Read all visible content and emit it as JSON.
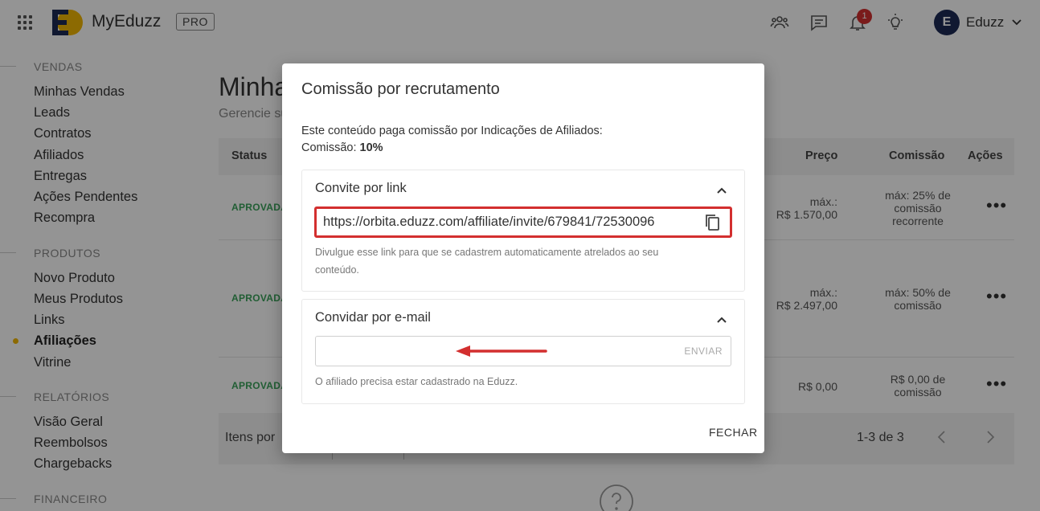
{
  "header": {
    "brand": "MyEduzz",
    "plan_badge": "PRO",
    "notification_count": "1",
    "user_initial": "E",
    "user_name": "Eduzz",
    "icons": [
      "apps-grid-icon",
      "people-icon",
      "chat-icon",
      "bell-icon",
      "lightbulb-icon",
      "chevron-down-icon"
    ],
    "logo_colors": {
      "dark": "#1c2a55",
      "yellow": "#f2b705"
    }
  },
  "sidebar": {
    "sections": [
      {
        "title": "VENDAS",
        "items": [
          "Minhas Vendas",
          "Leads",
          "Contratos",
          "Afiliados",
          "Entregas",
          "Ações Pendentes",
          "Recompra"
        ]
      },
      {
        "title": "PRODUTOS",
        "items": [
          "Novo Produto",
          "Meus Produtos",
          "Links",
          "Afiliações",
          "Vitrine"
        ]
      },
      {
        "title": "RELATÓRIOS",
        "items": [
          "Visão Geral",
          "Reembolsos",
          "Chargebacks"
        ]
      },
      {
        "title": "FINANCEIRO",
        "items": []
      }
    ],
    "active_item": "Afiliações",
    "active_color": "#f2b705"
  },
  "main": {
    "title": "Minhas Afiliações",
    "subtitle": "Gerencie suas afiliações",
    "columns": {
      "status": "Status",
      "price": "Preço",
      "commission": "Comissão",
      "actions": "Ações"
    },
    "rows": [
      {
        "status": "APROVADA",
        "price_line1": "máx.:",
        "price_line2": "R$ 1.570,00",
        "commission_lines": [
          "máx: 25% de",
          "comissão",
          "recorrente"
        ]
      },
      {
        "status": "APROVADA",
        "price_line1": "máx.:",
        "price_line2": "R$ 2.497,00",
        "commission_lines": [
          "máx: 50% de",
          "comissão"
        ]
      },
      {
        "status": "APROVADA",
        "price_line1": "",
        "price_line2": "R$ 0,00",
        "commission_lines": [
          "R$ 0,00 de",
          "comissão"
        ]
      }
    ],
    "footer": {
      "items_per_page_label": "Itens por",
      "pagination": "1-3 de 3"
    },
    "status_color": "#3aa35a"
  },
  "modal": {
    "title": "Comissão por recrutamento",
    "desc_line1": "Este conteúdo paga comissão por Indicações de Afiliados:",
    "commission_label": "Comissão: ",
    "commission_value": "10%",
    "link_panel": {
      "title": "Convite por link",
      "url": "https://orbita.eduzz.com/affiliate/invite/679841/72530096",
      "hint": "Divulgue esse link para que se cadastrem automaticamente atrelados ao seu conteúdo."
    },
    "email_panel": {
      "title": "Convidar por e-mail",
      "input_value": "",
      "send_label": "ENVIAR",
      "hint": "O afiliado precisa estar cadastrado na Eduzz."
    },
    "close_label": "FECHAR",
    "highlight_color": "#d32f2f"
  }
}
